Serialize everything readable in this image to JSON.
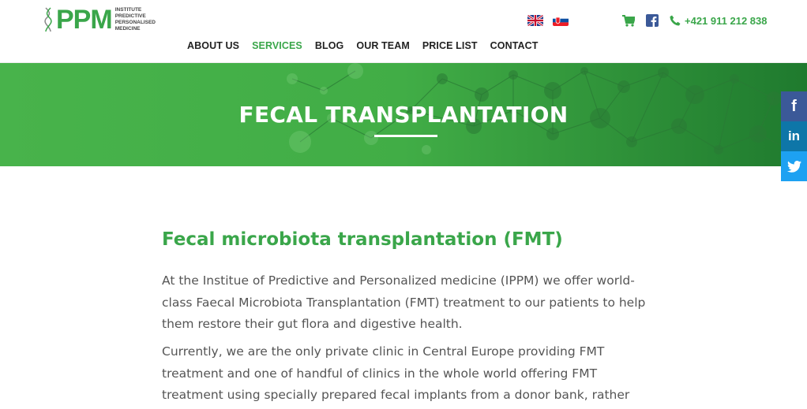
{
  "logo": {
    "mark": "PPM",
    "lines": [
      "INSTITUTE",
      "PREDICTIVE",
      "PERSONALISED",
      "MEDICINE"
    ]
  },
  "flags": [
    "english-flag",
    "slovak-flag"
  ],
  "contact": {
    "phone": "+421 911 212 838"
  },
  "nav": {
    "items": [
      "ABOUT US",
      "SERVICES",
      "BLOG",
      "OUR TEAM",
      "PRICE LIST",
      "CONTACT"
    ],
    "active": "SERVICES"
  },
  "hero": {
    "title": "FECAL TRANSPLANTATION"
  },
  "social": {
    "facebook": "f",
    "linkedin": "in"
  },
  "content": {
    "heading": "Fecal microbiota transplantation (FMT)",
    "paragraph1": "At the Institue of Predictive and Personalized medicine (IPPM) we offer world-class Faecal Microbiota Transplantation (FMT) treatment to our patients to help them restore their gut flora and digestive health.",
    "paragraph2": "Currently, we are the only private clinic in Central Europe providing FMT treatment and one of handful of clinics in the whole world offering FMT treatment using specially prepared fecal implants from a donor bank, rather"
  },
  "colors": {
    "brand_green": "#3aa64a",
    "hero_green": "#43b047",
    "facebook_blue": "#3b5998",
    "linkedin_blue": "#0e76a8",
    "twitter_blue": "#1da1f2"
  }
}
